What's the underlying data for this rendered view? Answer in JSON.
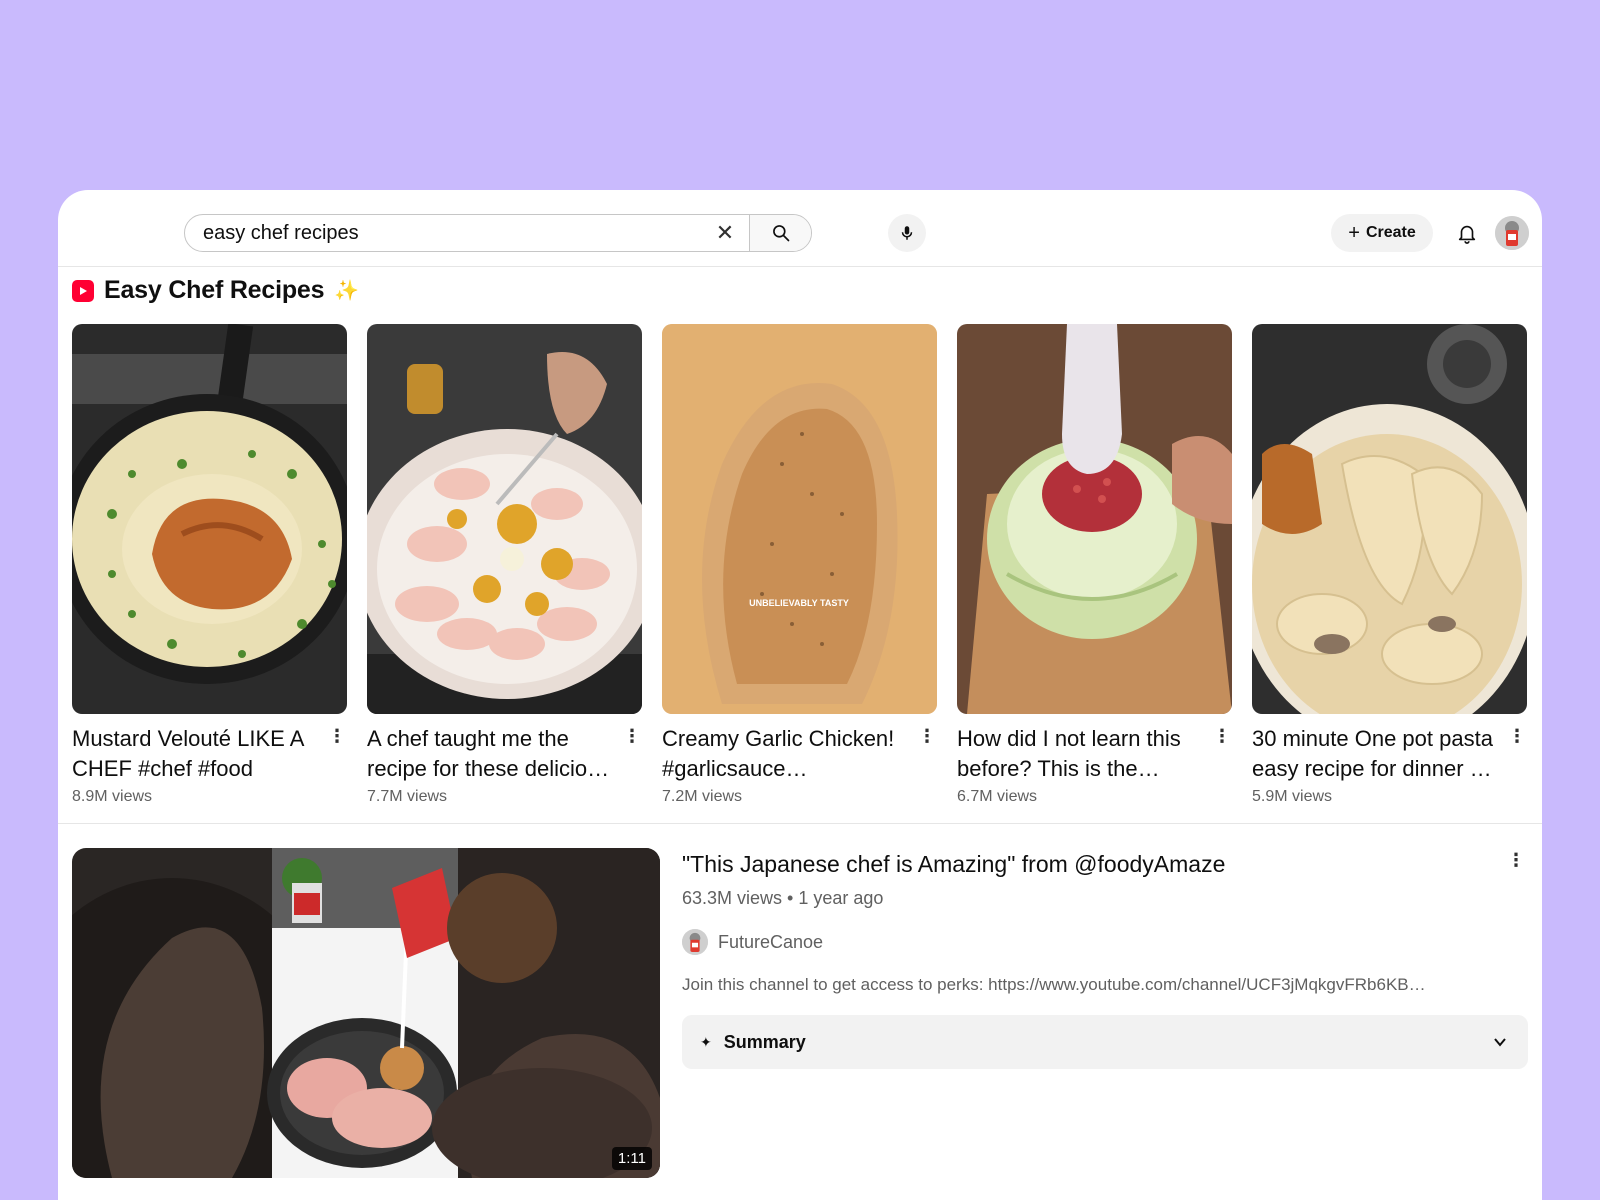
{
  "header": {
    "search": {
      "value": "easy chef recipes",
      "clear_icon": "close-icon",
      "search_icon": "search-icon"
    },
    "mic_icon": "microphone-icon",
    "create_label": "Create",
    "bell_icon": "bell-icon"
  },
  "shelf": {
    "title": "Easy Chef Recipes",
    "sparkle": "✨",
    "items": [
      {
        "title": "Mustard Velouté LIKE A CHEF #chef #food",
        "views": "8.9M views"
      },
      {
        "title": "A chef taught me the recipe for these delicio…",
        "views": "7.7M views"
      },
      {
        "title": "Creamy Garlic Chicken! #garlicsauce…",
        "views": "7.2M views",
        "overlay": "UNBELIEVABLY TASTY"
      },
      {
        "title": "How did I not learn this before? This is the…",
        "views": "6.7M views"
      },
      {
        "title": "30 minute One pot pasta easy recipe for dinner …",
        "views": "5.9M views"
      }
    ]
  },
  "video": {
    "title": "\"This Japanese chef is Amazing\" from @foodyAmaze",
    "meta": "63.3M views • 1 year ago",
    "channel": "FutureCanoe",
    "description": "Join this channel to get access to perks: https://www.youtube.com/channel/UCF3jMqkgvFRb6KB…",
    "duration": "1:11",
    "summary_label": "Summary"
  },
  "colors": {
    "background": "#c9bafd",
    "shorts_red": "#ff0033",
    "secondary_text": "#606060"
  }
}
